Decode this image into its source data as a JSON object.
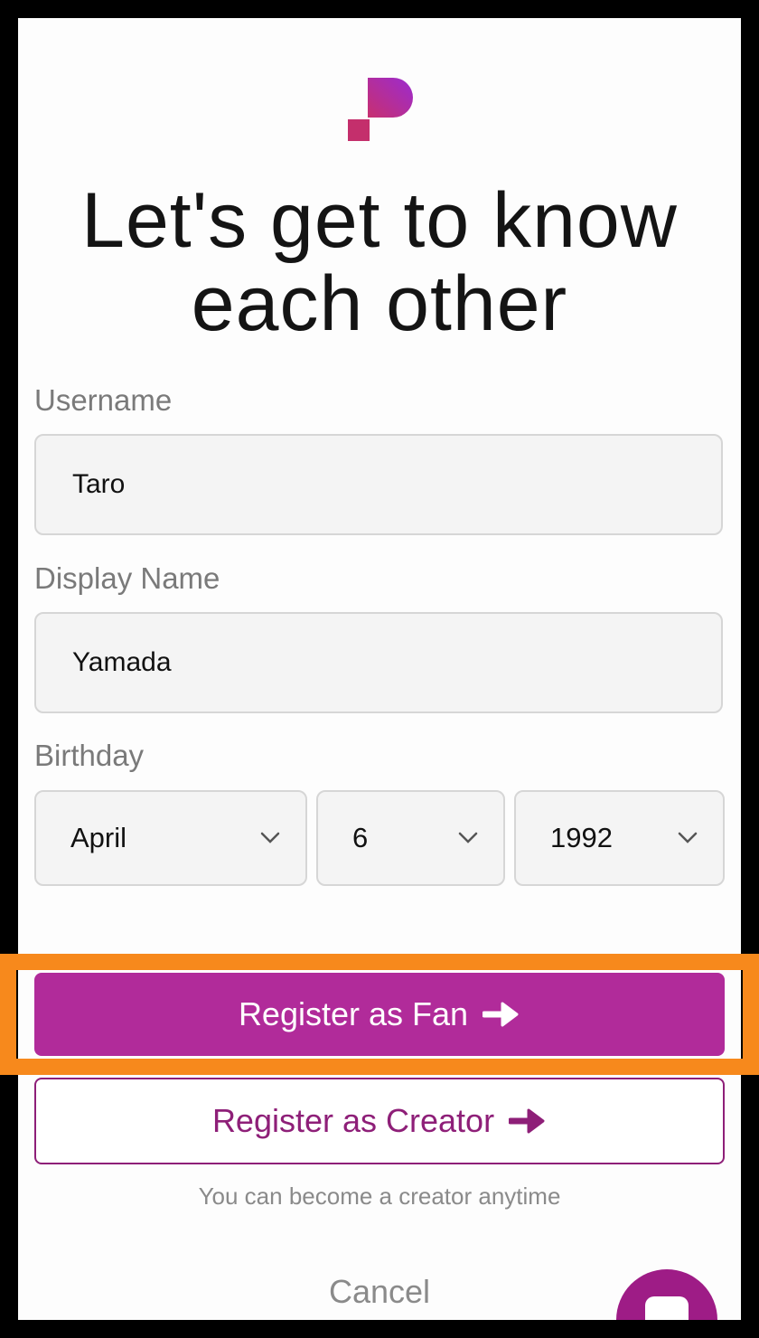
{
  "header": {
    "title": "Let's get to know each other"
  },
  "form": {
    "username": {
      "label": "Username",
      "value": "Taro"
    },
    "display_name": {
      "label": "Display Name",
      "value": "Yamada"
    },
    "birthday": {
      "label": "Birthday",
      "month": "April",
      "day": "6",
      "year": "1992"
    }
  },
  "actions": {
    "fan_label": "Register as Fan",
    "creator_label": "Register as Creator",
    "hint": "You can become a creator anytime",
    "cancel_label": "Cancel"
  },
  "icons": {
    "logo": "brand-logo",
    "select_chevron": "chevron-down-icon",
    "button_arrow": "arrow-right-icon",
    "fab": "chat-icon"
  },
  "colors": {
    "brand_primary": "#b12b9a",
    "brand_dark": "#8e1f78",
    "highlight": "#f7891c",
    "logo_gradient_start": "#c8306f",
    "logo_gradient_end": "#9b2bd0"
  }
}
